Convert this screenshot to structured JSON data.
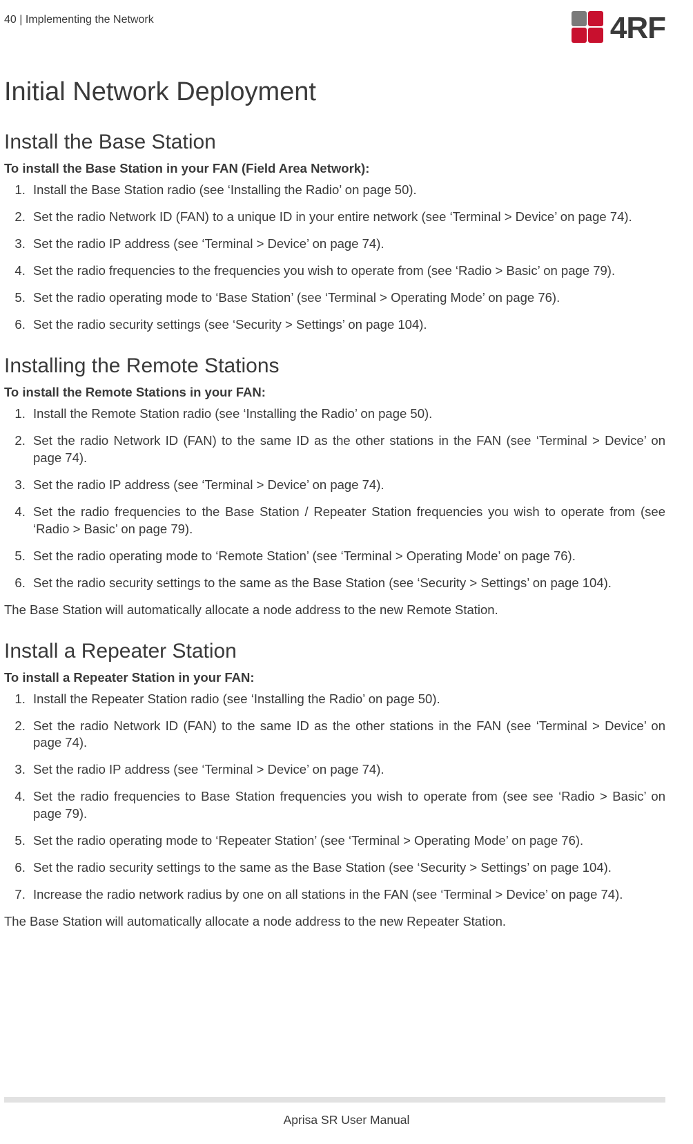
{
  "header": {
    "page_number": "40",
    "sep": "  |  ",
    "chapter": "Implementing the Network",
    "logo_text": "4RF"
  },
  "title": "Initial Network Deployment",
  "sections": [
    {
      "heading": "Install the Base Station",
      "subhead": "To install the Base Station in your FAN (Field Area Network):",
      "steps": [
        "Install the Base Station radio (see ‘Installing the Radio’ on page 50).",
        "Set the radio Network ID (FAN) to a unique ID in your entire network (see ‘Terminal > Device’ on page 74).",
        "Set the radio IP address (see ‘Terminal > Device’ on page 74).",
        "Set the radio frequencies to the frequencies you wish to operate from (see ‘Radio > Basic’ on page 79).",
        "Set the radio operating mode to ‘Base Station’ (see ‘Terminal > Operating Mode’ on page 76).",
        "Set the radio security settings (see ‘Security > Settings’ on page 104)."
      ],
      "trailing_note": ""
    },
    {
      "heading": "Installing the Remote Stations",
      "subhead": "To install the Remote Stations in your FAN:",
      "steps": [
        "Install the Remote Station radio (see ‘Installing the Radio’ on page 50).",
        "Set the radio Network ID (FAN) to the same ID as the other stations in the FAN (see ‘Terminal > Device’ on page 74).",
        "Set the radio IP address (see ‘Terminal > Device’ on page 74).",
        "Set the radio frequencies to the Base Station / Repeater Station frequencies you wish to operate from (see ‘Radio > Basic’ on page 79).",
        "Set the radio operating mode to ‘Remote Station’ (see ‘Terminal > Operating Mode’ on page 76).",
        "Set the radio security settings to the same as the Base Station (see ‘Security > Settings’ on page 104)."
      ],
      "trailing_note": "The Base Station will automatically allocate a node address to the new Remote Station."
    },
    {
      "heading": "Install a Repeater Station",
      "subhead": "To install a Repeater Station in your FAN:",
      "steps": [
        "Install the Repeater Station radio (see ‘Installing the Radio’ on page 50).",
        "Set the radio Network ID (FAN) to the same ID as the other stations in the FAN (see ‘Terminal > Device’ on page 74).",
        "Set the radio IP address (see ‘Terminal > Device’ on page 74).",
        "Set the radio frequencies to Base Station frequencies you wish to operate from (see see ‘Radio > Basic’ on page 79).",
        "Set the radio operating mode to ‘Repeater Station’ (see ‘Terminal > Operating Mode’ on page 76).",
        "Set the radio security settings to the same as the Base Station (see ‘Security > Settings’ on page 104).",
        "Increase the radio network radius by one on all stations in the FAN (see ‘Terminal > Device’ on page 74)."
      ],
      "trailing_note": "The Base Station will automatically allocate a node address to the new Repeater Station."
    }
  ],
  "footer": "Aprisa SR User Manual"
}
